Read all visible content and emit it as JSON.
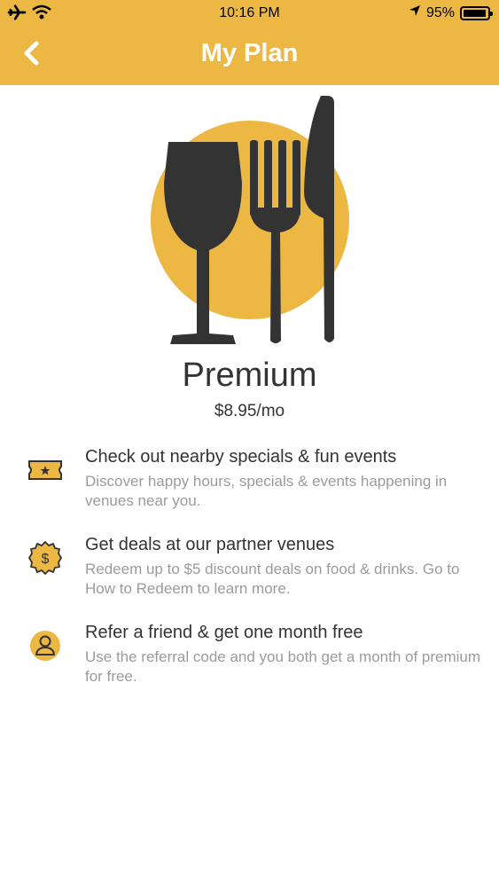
{
  "status_bar": {
    "time": "10:16 PM",
    "battery": "95%",
    "battery_level": 0.95
  },
  "nav": {
    "title": "My Plan"
  },
  "colors": {
    "accent": "#ECB843",
    "icon_dark": "#333333",
    "text_primary": "#333333",
    "text_secondary": "#9B9B9B"
  },
  "plan": {
    "name": "Premium",
    "price": "$8.95/mo"
  },
  "features": [
    {
      "icon": "ticket-icon",
      "title": "Check out nearby specials & fun events",
      "description": "Discover happy hours, specials & events happening in venues near you."
    },
    {
      "icon": "dollar-badge-icon",
      "title": "Get deals at our partner venues",
      "description": "Redeem up to $5 discount deals on food & drinks. Go to How to Redeem to learn more."
    },
    {
      "icon": "user-icon",
      "title": "Refer a friend & get one month free",
      "description": "Use the referral code and you both get a month of premium for free."
    }
  ]
}
